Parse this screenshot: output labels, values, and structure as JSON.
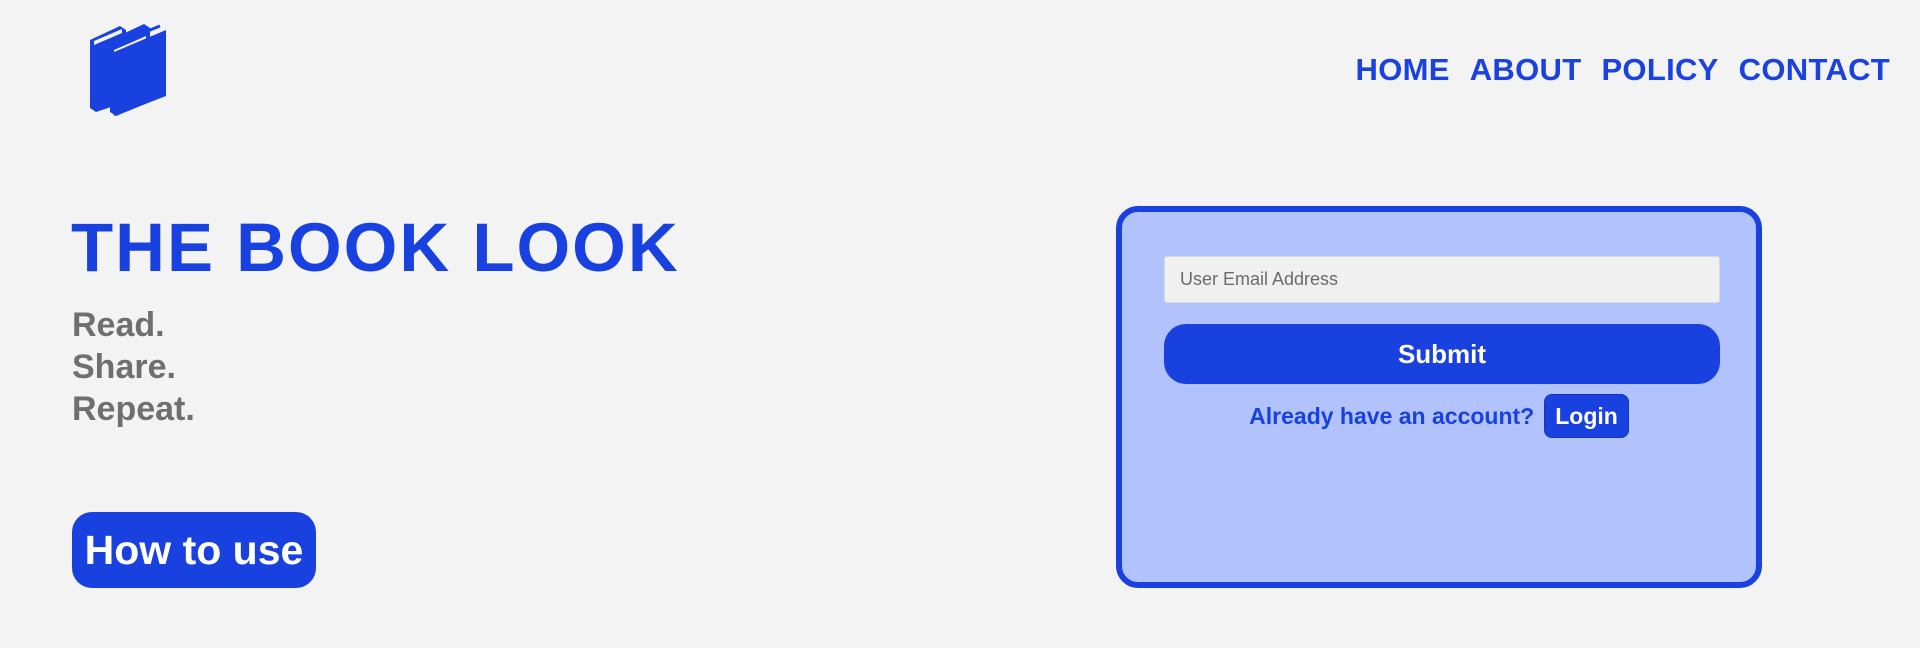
{
  "header": {
    "logo_icon": "books-icon",
    "nav": [
      {
        "label": "HOME"
      },
      {
        "label": "ABOUT"
      },
      {
        "label": "POLICY"
      },
      {
        "label": "CONTACT"
      }
    ]
  },
  "hero": {
    "title": "THE BOOK LOOK",
    "tagline": [
      "Read.",
      "Share.",
      "Repeat."
    ],
    "how_to_use_label": "How to use"
  },
  "signup": {
    "email_placeholder": "User Email Address",
    "email_value": "",
    "submit_label": "Submit",
    "account_prompt": "Already have an account?",
    "login_label": "Login"
  },
  "colors": {
    "brand_blue": "#1841e0",
    "card_background": "#b1c2fd",
    "page_background": "#f3f3f3",
    "tagline_gray": "#6f6f6f"
  }
}
